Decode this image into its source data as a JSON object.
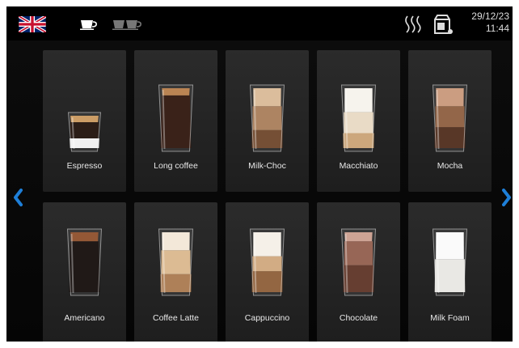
{
  "status": {
    "language_flag": "uk-flag-icon",
    "single_cup": "single-cup-icon",
    "double_cup": "double-cup-icon",
    "heating": "heating-icon",
    "milk": "milk-container-icon",
    "date": "29/12/23",
    "time": "11:44"
  },
  "colors": {
    "background": "#000000",
    "tile": "#262626",
    "label": "#e8e8e8",
    "arrow": "#1e7fd8"
  },
  "navigation": {
    "prev_icon": "chevron-left-icon",
    "next_icon": "chevron-right-icon"
  },
  "drinks": [
    {
      "label": "Espresso",
      "style": "espresso"
    },
    {
      "label": "Long coffee",
      "style": "long"
    },
    {
      "label": "Milk-Choc",
      "style": "milkchoc"
    },
    {
      "label": "Macchiato",
      "style": "macchiato"
    },
    {
      "label": "Mocha",
      "style": "mocha"
    },
    {
      "label": "Americano",
      "style": "americano"
    },
    {
      "label": "Coffee Latte",
      "style": "latte"
    },
    {
      "label": "Cappuccino",
      "style": "cappuccino"
    },
    {
      "label": "Chocolate",
      "style": "chocolate"
    },
    {
      "label": "Milk Foam",
      "style": "milkfoam"
    }
  ]
}
